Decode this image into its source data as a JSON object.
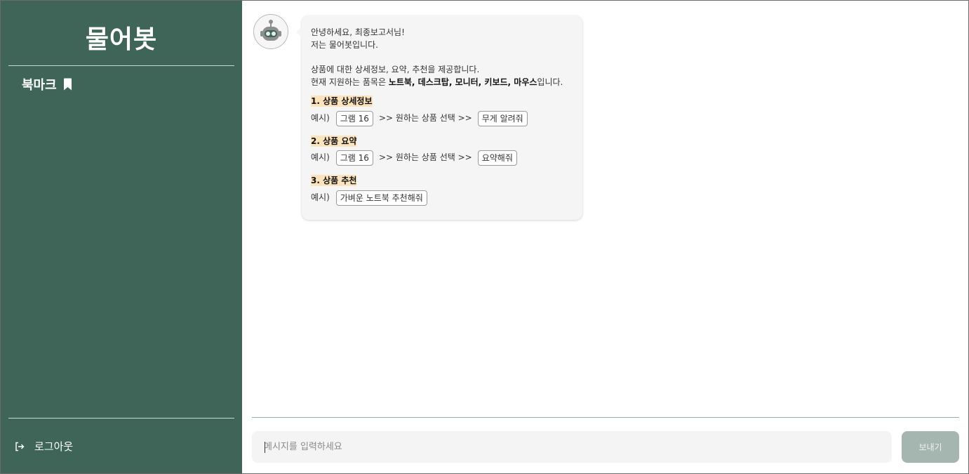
{
  "sidebar": {
    "brand": "물어봇",
    "bookmark_label": "북마크",
    "logout_label": "로그아웃"
  },
  "chat": {
    "greeting_1": "안녕하세요, 최종보고서님!",
    "greeting_2": "저는 물어봇입니다.",
    "intro_1": "상품에 대한 상세정보, 요약, 추천을 제공합니다.",
    "intro_2_prefix": "현재 지원하는 품목은 ",
    "intro_2_items": "노트북, 데스크탑, 모니터, 키보드, 마우스",
    "intro_2_suffix": "입니다.",
    "example_prefix": "예시)",
    "sections": [
      {
        "title": "1. 상품 상세정보",
        "chip_1": "그램 16",
        "arrow_text": ">> 원하는 상품 선택 >>",
        "chip_2": "무게 알려줘"
      },
      {
        "title": "2. 상품 요약",
        "chip_1": "그램 16",
        "arrow_text": ">> 원하는 상품 선택 >>",
        "chip_2": "요약해줘"
      },
      {
        "title": "3. 상품 추천",
        "chip_1": "가벼운 노트북 추천해줘"
      }
    ]
  },
  "composer": {
    "placeholder": "메시지를 입력하세요",
    "send_label": "보내기"
  },
  "colors": {
    "sidebar_bg": "#3e6558",
    "highlight": "#fbe3bd",
    "send_button": "#a4b6af"
  },
  "icons": [
    "bookmark-icon",
    "logout-icon",
    "robot-icon"
  ]
}
